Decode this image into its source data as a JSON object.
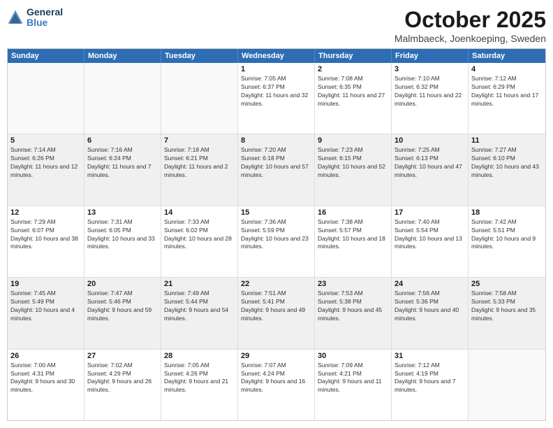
{
  "logo": {
    "general": "General",
    "blue": "Blue"
  },
  "title": {
    "month": "October 2025",
    "location": "Malmbaeck, Joenkoeping, Sweden"
  },
  "calendar": {
    "headers": [
      "Sunday",
      "Monday",
      "Tuesday",
      "Wednesday",
      "Thursday",
      "Friday",
      "Saturday"
    ],
    "rows": [
      [
        {
          "day": "",
          "sunrise": "",
          "sunset": "",
          "daylight": "",
          "empty": true
        },
        {
          "day": "",
          "sunrise": "",
          "sunset": "",
          "daylight": "",
          "empty": true
        },
        {
          "day": "",
          "sunrise": "",
          "sunset": "",
          "daylight": "",
          "empty": true
        },
        {
          "day": "1",
          "sunrise": "Sunrise: 7:05 AM",
          "sunset": "Sunset: 6:37 PM",
          "daylight": "Daylight: 11 hours and 32 minutes."
        },
        {
          "day": "2",
          "sunrise": "Sunrise: 7:08 AM",
          "sunset": "Sunset: 6:35 PM",
          "daylight": "Daylight: 11 hours and 27 minutes."
        },
        {
          "day": "3",
          "sunrise": "Sunrise: 7:10 AM",
          "sunset": "Sunset: 6:32 PM",
          "daylight": "Daylight: 11 hours and 22 minutes."
        },
        {
          "day": "4",
          "sunrise": "Sunrise: 7:12 AM",
          "sunset": "Sunset: 6:29 PM",
          "daylight": "Daylight: 11 hours and 17 minutes."
        }
      ],
      [
        {
          "day": "5",
          "sunrise": "Sunrise: 7:14 AM",
          "sunset": "Sunset: 6:26 PM",
          "daylight": "Daylight: 11 hours and 12 minutes."
        },
        {
          "day": "6",
          "sunrise": "Sunrise: 7:16 AM",
          "sunset": "Sunset: 6:24 PM",
          "daylight": "Daylight: 11 hours and 7 minutes."
        },
        {
          "day": "7",
          "sunrise": "Sunrise: 7:18 AM",
          "sunset": "Sunset: 6:21 PM",
          "daylight": "Daylight: 11 hours and 2 minutes."
        },
        {
          "day": "8",
          "sunrise": "Sunrise: 7:20 AM",
          "sunset": "Sunset: 6:18 PM",
          "daylight": "Daylight: 10 hours and 57 minutes."
        },
        {
          "day": "9",
          "sunrise": "Sunrise: 7:23 AM",
          "sunset": "Sunset: 6:15 PM",
          "daylight": "Daylight: 10 hours and 52 minutes."
        },
        {
          "day": "10",
          "sunrise": "Sunrise: 7:25 AM",
          "sunset": "Sunset: 6:13 PM",
          "daylight": "Daylight: 10 hours and 47 minutes."
        },
        {
          "day": "11",
          "sunrise": "Sunrise: 7:27 AM",
          "sunset": "Sunset: 6:10 PM",
          "daylight": "Daylight: 10 hours and 43 minutes."
        }
      ],
      [
        {
          "day": "12",
          "sunrise": "Sunrise: 7:29 AM",
          "sunset": "Sunset: 6:07 PM",
          "daylight": "Daylight: 10 hours and 38 minutes."
        },
        {
          "day": "13",
          "sunrise": "Sunrise: 7:31 AM",
          "sunset": "Sunset: 6:05 PM",
          "daylight": "Daylight: 10 hours and 33 minutes."
        },
        {
          "day": "14",
          "sunrise": "Sunrise: 7:33 AM",
          "sunset": "Sunset: 6:02 PM",
          "daylight": "Daylight: 10 hours and 28 minutes."
        },
        {
          "day": "15",
          "sunrise": "Sunrise: 7:36 AM",
          "sunset": "Sunset: 5:59 PM",
          "daylight": "Daylight: 10 hours and 23 minutes."
        },
        {
          "day": "16",
          "sunrise": "Sunrise: 7:38 AM",
          "sunset": "Sunset: 5:57 PM",
          "daylight": "Daylight: 10 hours and 18 minutes."
        },
        {
          "day": "17",
          "sunrise": "Sunrise: 7:40 AM",
          "sunset": "Sunset: 5:54 PM",
          "daylight": "Daylight: 10 hours and 13 minutes."
        },
        {
          "day": "18",
          "sunrise": "Sunrise: 7:42 AM",
          "sunset": "Sunset: 5:51 PM",
          "daylight": "Daylight: 10 hours and 9 minutes."
        }
      ],
      [
        {
          "day": "19",
          "sunrise": "Sunrise: 7:45 AM",
          "sunset": "Sunset: 5:49 PM",
          "daylight": "Daylight: 10 hours and 4 minutes."
        },
        {
          "day": "20",
          "sunrise": "Sunrise: 7:47 AM",
          "sunset": "Sunset: 5:46 PM",
          "daylight": "Daylight: 9 hours and 59 minutes."
        },
        {
          "day": "21",
          "sunrise": "Sunrise: 7:49 AM",
          "sunset": "Sunset: 5:44 PM",
          "daylight": "Daylight: 9 hours and 54 minutes."
        },
        {
          "day": "22",
          "sunrise": "Sunrise: 7:51 AM",
          "sunset": "Sunset: 5:41 PM",
          "daylight": "Daylight: 9 hours and 49 minutes."
        },
        {
          "day": "23",
          "sunrise": "Sunrise: 7:53 AM",
          "sunset": "Sunset: 5:38 PM",
          "daylight": "Daylight: 9 hours and 45 minutes."
        },
        {
          "day": "24",
          "sunrise": "Sunrise: 7:56 AM",
          "sunset": "Sunset: 5:36 PM",
          "daylight": "Daylight: 9 hours and 40 minutes."
        },
        {
          "day": "25",
          "sunrise": "Sunrise: 7:58 AM",
          "sunset": "Sunset: 5:33 PM",
          "daylight": "Daylight: 9 hours and 35 minutes."
        }
      ],
      [
        {
          "day": "26",
          "sunrise": "Sunrise: 7:00 AM",
          "sunset": "Sunset: 4:31 PM",
          "daylight": "Daylight: 9 hours and 30 minutes."
        },
        {
          "day": "27",
          "sunrise": "Sunrise: 7:02 AM",
          "sunset": "Sunset: 4:29 PM",
          "daylight": "Daylight: 9 hours and 26 minutes."
        },
        {
          "day": "28",
          "sunrise": "Sunrise: 7:05 AM",
          "sunset": "Sunset: 4:26 PM",
          "daylight": "Daylight: 9 hours and 21 minutes."
        },
        {
          "day": "29",
          "sunrise": "Sunrise: 7:07 AM",
          "sunset": "Sunset: 4:24 PM",
          "daylight": "Daylight: 9 hours and 16 minutes."
        },
        {
          "day": "30",
          "sunrise": "Sunrise: 7:09 AM",
          "sunset": "Sunset: 4:21 PM",
          "daylight": "Daylight: 9 hours and 11 minutes."
        },
        {
          "day": "31",
          "sunrise": "Sunrise: 7:12 AM",
          "sunset": "Sunset: 4:19 PM",
          "daylight": "Daylight: 9 hours and 7 minutes."
        },
        {
          "day": "",
          "sunrise": "",
          "sunset": "",
          "daylight": "",
          "empty": true
        }
      ]
    ]
  }
}
